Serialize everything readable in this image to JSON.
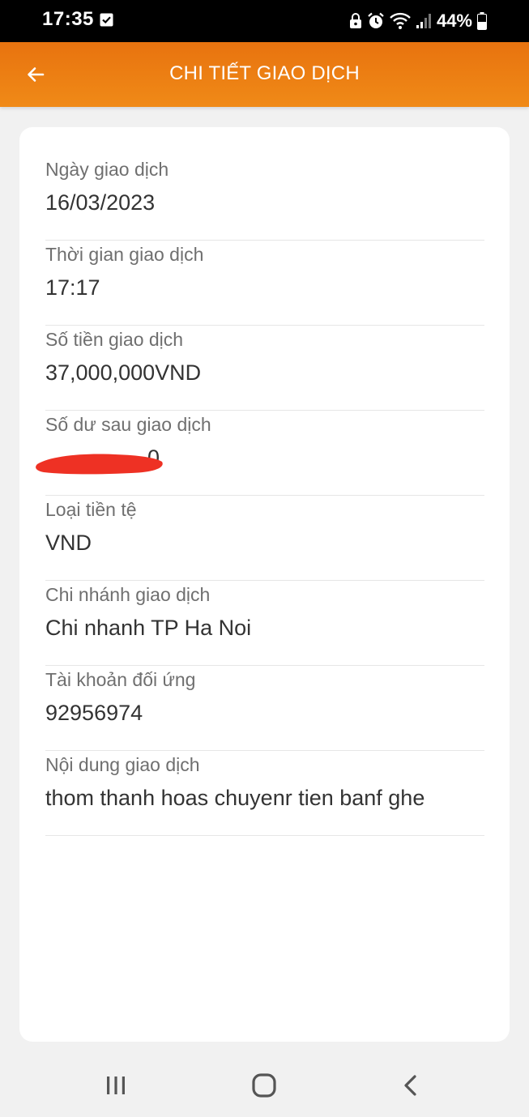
{
  "status_bar": {
    "time": "17:35",
    "battery": "44%"
  },
  "header": {
    "title": "CHI TIẾT GIAO DỊCH"
  },
  "details": [
    {
      "label": "Ngày giao dịch",
      "value": "16/03/2023"
    },
    {
      "label": "Thời gian giao dịch",
      "value": "17:17"
    },
    {
      "label": "Số tiền giao dịch",
      "value": "37,000,000VND"
    },
    {
      "label": "Số dư sau giao dịch",
      "value": "0"
    },
    {
      "label": "Loại tiền tệ",
      "value": "VND"
    },
    {
      "label": "Chi nhánh giao dịch",
      "value": "Chi nhanh TP Ha Noi"
    },
    {
      "label": "Tài khoản đối ứng",
      "value": "92956974"
    },
    {
      "label": "Nội dung giao dịch",
      "value": "thom thanh hoas chuyenr tien banf ghe"
    }
  ],
  "colors": {
    "header_gradient_start": "#e8730f",
    "header_gradient_end": "#f08a17",
    "redaction": "#ee3124"
  },
  "icons": {
    "back": "arrow-left-icon",
    "recents": "recent-apps-icon",
    "home": "home-icon",
    "nav_back": "chevron-left-icon"
  }
}
